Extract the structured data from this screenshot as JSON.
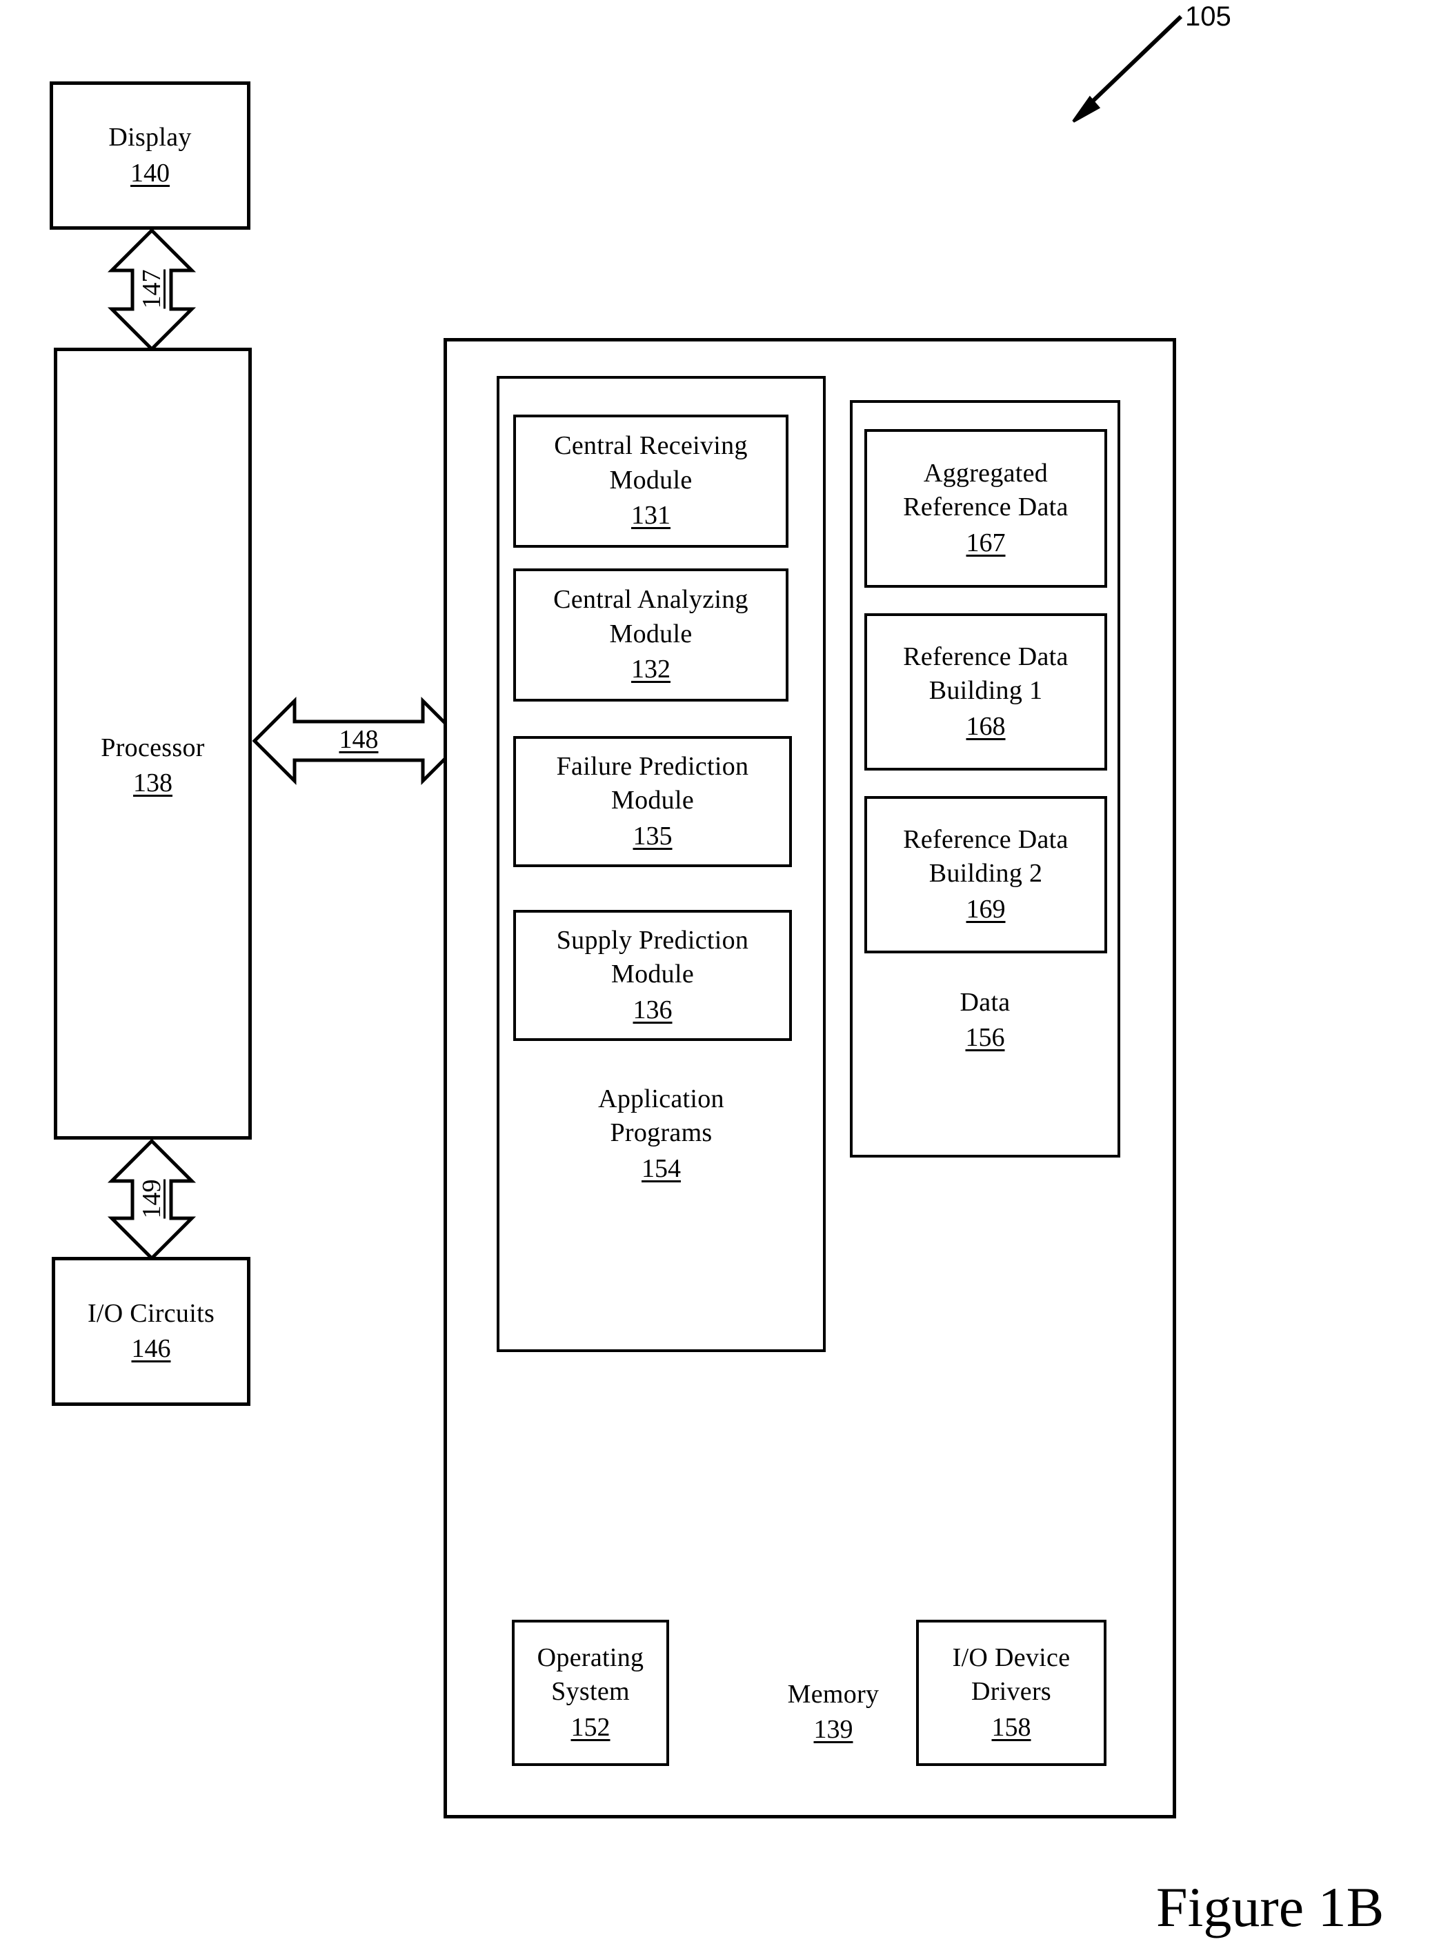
{
  "figure": {
    "caption": "Figure 1B",
    "system_ref": "105"
  },
  "blocks": {
    "display": {
      "label": "Display",
      "ref": "140"
    },
    "processor": {
      "label": "Processor",
      "ref": "138"
    },
    "io_circuits": {
      "label": "I/O Circuits",
      "ref": "146"
    },
    "memory": {
      "label": "Memory",
      "ref": "139"
    },
    "application_programs": {
      "label_line1": "Application",
      "label_line2": "Programs",
      "ref": "154"
    },
    "data": {
      "label": "Data",
      "ref": "156"
    },
    "operating_system": {
      "label_line1": "Operating",
      "label_line2": "System",
      "ref": "152"
    },
    "io_device_drivers": {
      "label_line1": "I/O Device",
      "label_line2": "Drivers",
      "ref": "158"
    }
  },
  "modules": [
    {
      "line1": "Central Receiving",
      "line2": "Module",
      "ref": "131"
    },
    {
      "line1": "Central Analyzing",
      "line2": "Module",
      "ref": "132"
    },
    {
      "line1": "Failure Prediction",
      "line2": "Module",
      "ref": "135"
    },
    {
      "line1": "Supply Prediction",
      "line2": "Module",
      "ref": "136"
    }
  ],
  "data_stores": [
    {
      "line1": "Aggregated",
      "line2": "Reference Data",
      "ref": "167"
    },
    {
      "line1": "Reference Data",
      "line2": "Building 1",
      "ref": "168"
    },
    {
      "line1": "Reference Data",
      "line2": "Building 2",
      "ref": "169"
    }
  ],
  "connectors": [
    {
      "name": "display-processor",
      "ref": "147",
      "orientation": "vertical"
    },
    {
      "name": "processor-memory",
      "ref": "148",
      "orientation": "horizontal"
    },
    {
      "name": "processor-io",
      "ref": "149",
      "orientation": "vertical"
    }
  ],
  "colors": {
    "stroke": "#000000",
    "background": "#ffffff"
  }
}
